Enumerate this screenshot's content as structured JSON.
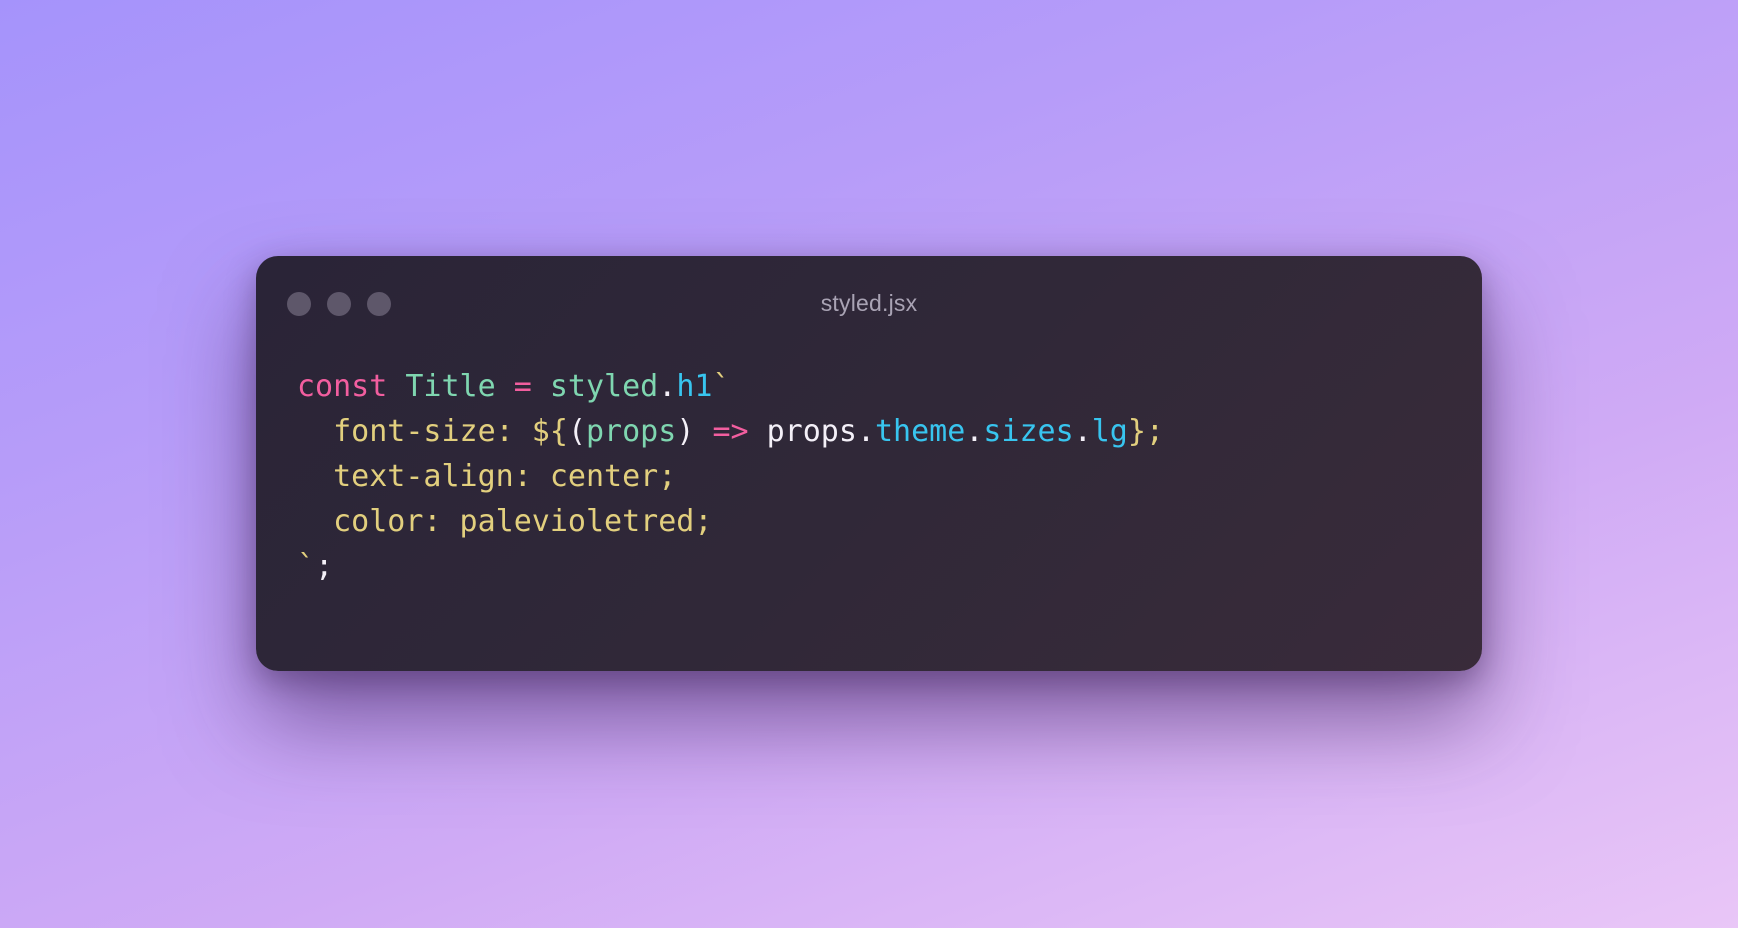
{
  "window": {
    "filename": "styled.jsx",
    "traffic_lights": [
      "close-dot",
      "minimize-dot",
      "zoom-dot"
    ]
  },
  "colors": {
    "keyword": "#f25e9f",
    "name": "#7fd6b0",
    "property": "#38c5ef",
    "css_text": "#e2cf7e",
    "plain": "#f4f0f8",
    "window_bg": "#2c2637"
  },
  "code": {
    "line1": {
      "t1": "const",
      "t2": " ",
      "t3": "Title",
      "t4": " ",
      "t5": "=",
      "t6": " ",
      "t7": "styled",
      "t8": ".",
      "t9": "h1",
      "t10": "`"
    },
    "line2": {
      "t1": "  font-size: ${",
      "t2": "(",
      "t3": "props",
      "t4": ")",
      "t5": " ",
      "t6": "=>",
      "t7": " ",
      "t8": "props",
      "t9": ".",
      "t10": "theme",
      "t11": ".",
      "t12": "sizes",
      "t13": ".",
      "t14": "lg",
      "t15": "};"
    },
    "line3": {
      "t1": "  text-align: center;"
    },
    "line4": {
      "t1": "  color: palevioletred;"
    },
    "line5": {
      "t1": "`",
      "t2": ";"
    }
  }
}
